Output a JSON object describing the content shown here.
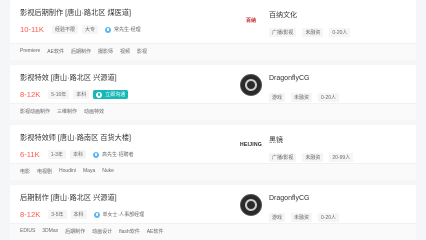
{
  "jobs": [
    {
      "title": "影视后期制作 [唐山·路北区 煤医道]",
      "salary": "10-11K",
      "tags": [
        "经验不限",
        "大专"
      ],
      "hr": "常先生·经理",
      "company_name": "百纳文化",
      "logo_text": "百纳",
      "company_info": [
        "广播/影视",
        "未融资",
        "0-20人"
      ],
      "skills": [
        "Premiere",
        "AE软件",
        "后期制作",
        "摄影师",
        "视频",
        "影视"
      ]
    },
    {
      "title": "影视特效 [唐山·路北区 兴源道]",
      "salary": "8-12K",
      "tags": [
        "5-10年",
        "本科"
      ],
      "hr": "立即沟通",
      "company_name": "DragonflyCG",
      "company_info": [
        "游戏",
        "未融资",
        "0-20人"
      ],
      "skills": [
        "影视动画制作",
        "三维制作",
        "动画特效"
      ]
    },
    {
      "title": "影视特效师 [唐山·路南区 百货大楼]",
      "salary": "6-11K",
      "tags": [
        "1-3年",
        "本科"
      ],
      "hr": "高先生·招聘者",
      "company_name": "黑镜",
      "logo_text": "HEIJING",
      "company_info": [
        "广播/影视",
        "未融资",
        "20-99人"
      ],
      "skills": [
        "电影",
        "电视剧",
        "Houdini",
        "Maya",
        "Nuke"
      ]
    },
    {
      "title": "后期制作 [唐山·路北区 兴源道]",
      "salary": "8-12K",
      "tags": [
        "3-5年",
        "本科"
      ],
      "hr": "单女士·人事部经理",
      "company_name": "DragonflyCG",
      "company_info": [
        "游戏",
        "未融资",
        "0-20人"
      ],
      "skills": [
        "EDIUS",
        "3DMax",
        "后期制作",
        "动画设计",
        "flash软件",
        "AE软件"
      ]
    }
  ]
}
